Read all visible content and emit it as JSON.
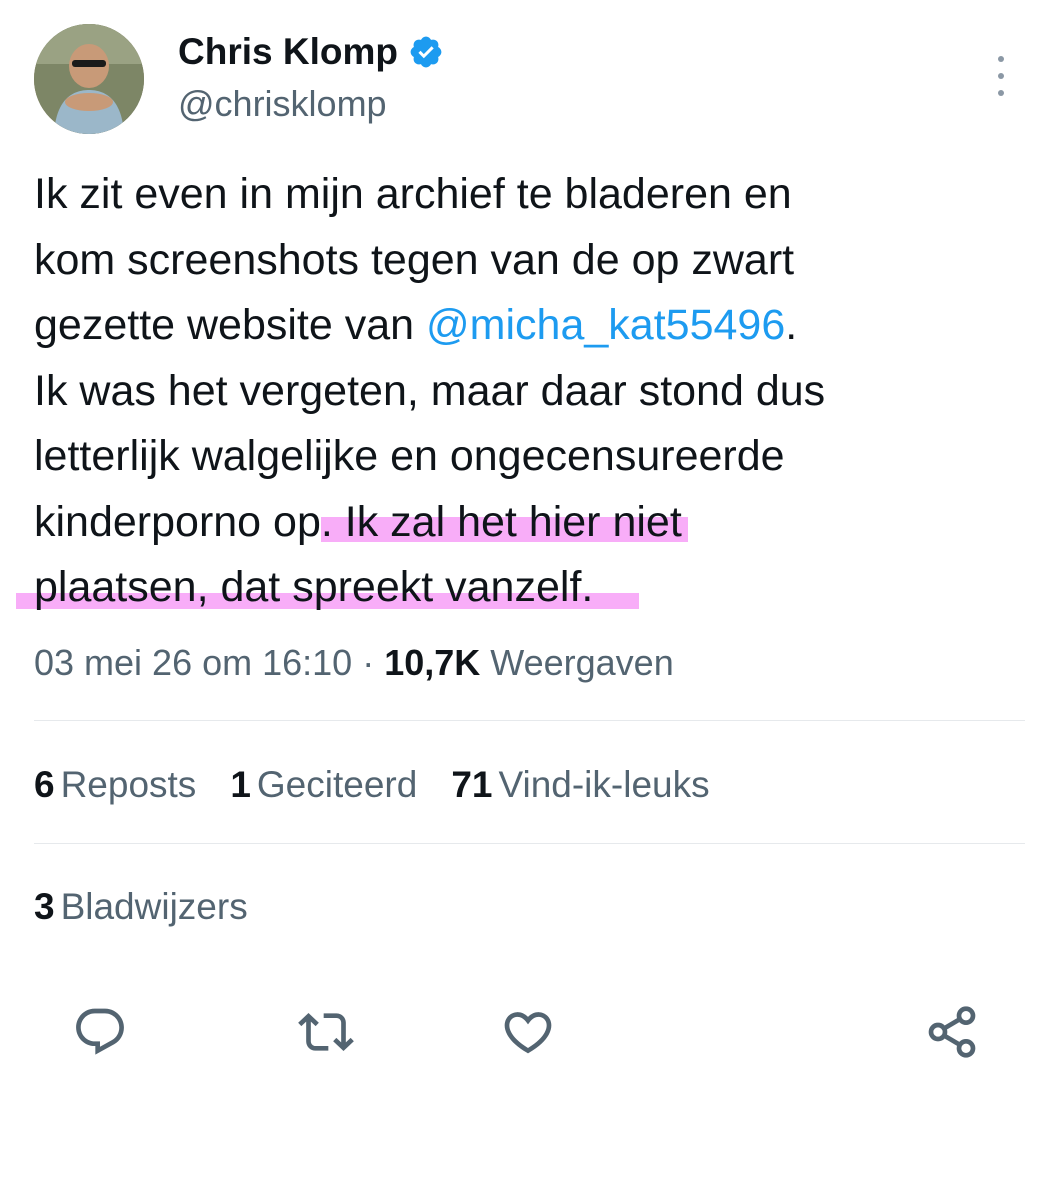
{
  "author": {
    "display_name": "Chris Klomp",
    "handle": "@chrisklomp",
    "verified": true
  },
  "tweet": {
    "line1": "Ik zit even in mijn archief te bladeren en",
    "line2": "kom screenshots tegen van de op zwart",
    "line3_prefix": "gezette website van ",
    "mention": "@micha_kat55496",
    "line3_suffix": ".",
    "line4": "Ik was het vergeten, maar daar stond dus",
    "line5": "letterlijk walgelijke en ongecensureerde",
    "line6_plain": "kinderporno op",
    "line6_highlight": ". Ik zal het hier niet",
    "line7_highlight": "plaatsen, dat spreekt vanzelf."
  },
  "meta": {
    "timestamp": "03 mei 26 om 16:10",
    "separator": " · ",
    "views_count": "10,7K",
    "views_label": " Weergaven"
  },
  "stats": {
    "reposts_count": "6",
    "reposts_label": "Reposts",
    "quotes_count": "1",
    "quotes_label": "Geciteerd",
    "likes_count": "71",
    "likes_label": "Vind-ik-leuks",
    "bookmarks_count": "3",
    "bookmarks_label": "Bladwijzers"
  },
  "colors": {
    "text": "#0f1419",
    "secondary": "#536471",
    "link": "#1d9bf0",
    "highlight": "#f8adf8",
    "verified": "#1d9bf0"
  },
  "icons": [
    "verified-badge-icon",
    "more-icon",
    "reply-icon",
    "repost-icon",
    "like-icon",
    "share-icon"
  ]
}
